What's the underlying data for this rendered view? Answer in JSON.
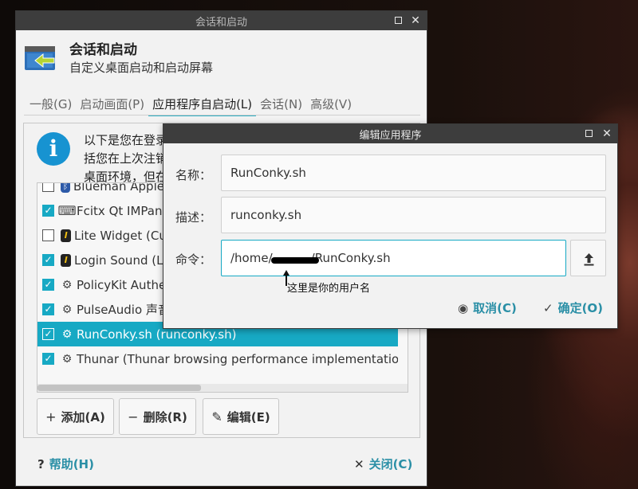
{
  "main_window": {
    "title": "会话和启动",
    "app_title": "会话和启动",
    "app_subtitle": "自定义桌面启动和启动屏幕",
    "tabs": [
      {
        "label": "一般(G)",
        "active": false
      },
      {
        "label": "启动画面(P)",
        "active": false
      },
      {
        "label": "应用程序自启动(L)",
        "active": true
      },
      {
        "label": "会话(N)",
        "active": false
      },
      {
        "label": "高级(V)",
        "active": false
      }
    ],
    "info_lines": [
      "以下是您在登录",
      "括您在上次注销",
      "桌面环境，但在"
    ],
    "autostart_items": [
      {
        "label": "Blueman Applet",
        "checked": false,
        "icon": "bluetooth-icon"
      },
      {
        "label": "Fcitx Qt IMPanel",
        "checked": true,
        "icon": "keyboard-icon"
      },
      {
        "label": "Lite Widget (Cus",
        "checked": false,
        "icon": "lite-icon"
      },
      {
        "label": "Login Sound (Lir",
        "checked": true,
        "icon": "lite-icon"
      },
      {
        "label": "PolicyKit Authen",
        "checked": true,
        "icon": "gear-icon"
      },
      {
        "label": "PulseAudio 声音",
        "checked": true,
        "icon": "gear-icon"
      },
      {
        "label": "RunConky.sh (runconky.sh)",
        "checked": true,
        "icon": "gear-icon",
        "selected": true
      },
      {
        "label": "Thunar (Thunar browsing performance implementation)",
        "checked": true,
        "icon": "gear-icon"
      }
    ],
    "buttons": {
      "add": "添加(A)",
      "remove": "删除(R)",
      "edit": "编辑(E)"
    },
    "footer": {
      "help": "帮助(H)",
      "close": "关闭(C)"
    }
  },
  "edit_dialog": {
    "title": "编辑应用程序",
    "name_label": "名称：",
    "name_value": "RunConky.sh",
    "desc_label": "描述：",
    "desc_value": "runconky.sh",
    "cmd_label": "命令：",
    "cmd_prefix": "/home/",
    "cmd_suffix": "/RunConky.sh",
    "annotation": "这里是你的用户名",
    "cancel": "取消(C)",
    "ok": "确定(O)"
  },
  "colors": {
    "accent": "#17a9c4",
    "link": "#2a8fa6",
    "titlebar": "#3d3d3d",
    "info_icon": "#1793d1"
  }
}
